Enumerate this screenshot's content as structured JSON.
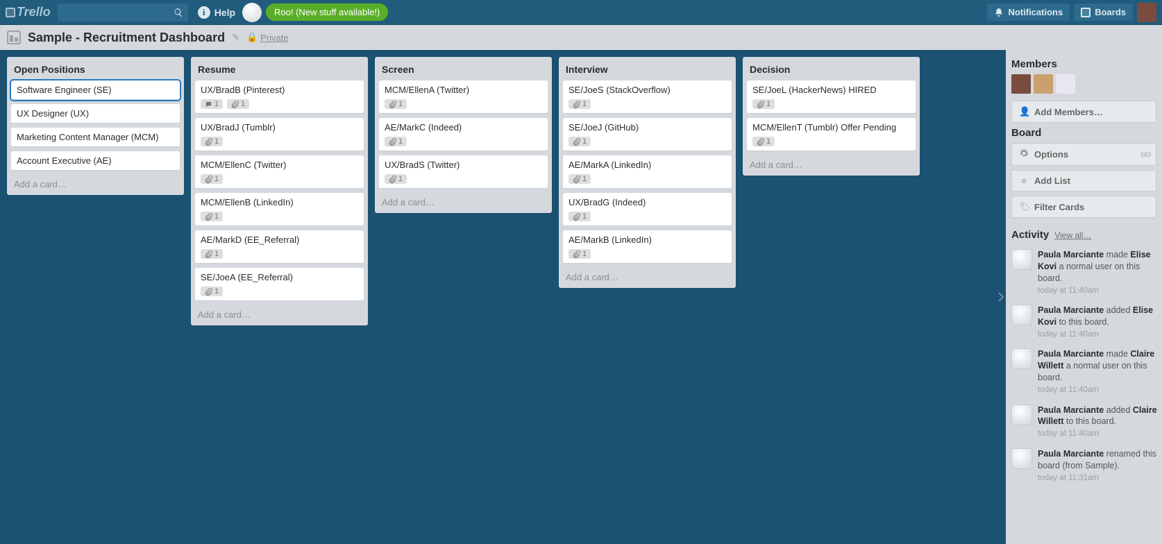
{
  "brand": "Trello",
  "help_label": "Help",
  "roo_label": "Roo! (New stuff available!)",
  "notifications_label": "Notifications",
  "boards_label": "Boards",
  "board_title": "Sample - Recruitment Dashboard",
  "private_label": "Private",
  "add_card_label": "Add a card…",
  "lists": [
    {
      "title": "Open Positions",
      "cards": [
        {
          "title": "Software Engineer (SE)",
          "selected": true
        },
        {
          "title": "UX Designer (UX)"
        },
        {
          "title": "Marketing Content Manager (MCM)"
        },
        {
          "title": "Account Executive (AE)"
        }
      ]
    },
    {
      "title": "Resume",
      "cards": [
        {
          "title": "UX/BradB (Pinterest)",
          "comments": 1,
          "attachments": 1
        },
        {
          "title": "UX/BradJ (Tumblr)",
          "attachments": 1
        },
        {
          "title": "MCM/EllenC (Twitter)",
          "attachments": 1
        },
        {
          "title": "MCM/EllenB (LinkedIn)",
          "attachments": 1
        },
        {
          "title": "AE/MarkD (EE_Referral)",
          "attachments": 1
        },
        {
          "title": "SE/JoeA (EE_Referral)",
          "attachments": 1
        }
      ]
    },
    {
      "title": "Screen",
      "cards": [
        {
          "title": "MCM/EllenA (Twitter)",
          "attachments": 1
        },
        {
          "title": "AE/MarkC (Indeed)",
          "attachments": 1
        },
        {
          "title": "UX/BradS (Twitter)",
          "attachments": 1
        }
      ]
    },
    {
      "title": "Interview",
      "cards": [
        {
          "title": "SE/JoeS (StackOverflow)",
          "attachments": 1
        },
        {
          "title": "SE/JoeJ (GitHub)",
          "attachments": 1
        },
        {
          "title": "AE/MarkA (LinkedIn)",
          "attachments": 1
        },
        {
          "title": "UX/BradG (Indeed)",
          "attachments": 1
        },
        {
          "title": "AE/MarkB (LinkedIn)",
          "attachments": 1
        }
      ]
    },
    {
      "title": "Decision",
      "cards": [
        {
          "title": "SE/JoeL (HackerNews) HIRED",
          "attachments": 1
        },
        {
          "title": "MCM/EllenT (Tumblr) Offer Pending",
          "attachments": 1
        }
      ]
    }
  ],
  "sidebar": {
    "members_heading": "Members",
    "add_members_label": "Add Members…",
    "board_heading": "Board",
    "options_label": "Options",
    "add_list_label": "Add List",
    "filter_cards_label": "Filter Cards",
    "activity_heading": "Activity",
    "view_all_label": "View all…",
    "member_colors": [
      "#7a4c3f",
      "#caa06f",
      "#e8e8f2"
    ],
    "activities": [
      {
        "html": "<b>Paula Marciante</b> made <b>Elise Kovi</b> a normal user on this board.",
        "time": "today at 11:40am"
      },
      {
        "html": "<b>Paula Marciante</b> added <b>Elise Kovi</b> to this board.",
        "time": "today at 11:40am"
      },
      {
        "html": "<b>Paula Marciante</b> made <b>Claire Willett</b> a normal user on this board.",
        "time": "today at 11:40am"
      },
      {
        "html": "<b>Paula Marciante</b> added <b>Claire Willett</b> to this board.",
        "time": "today at 11:40am"
      },
      {
        "html": "<b>Paula Marciante</b> renamed this board (from Sample).",
        "time": "today at 11:31am"
      }
    ]
  }
}
